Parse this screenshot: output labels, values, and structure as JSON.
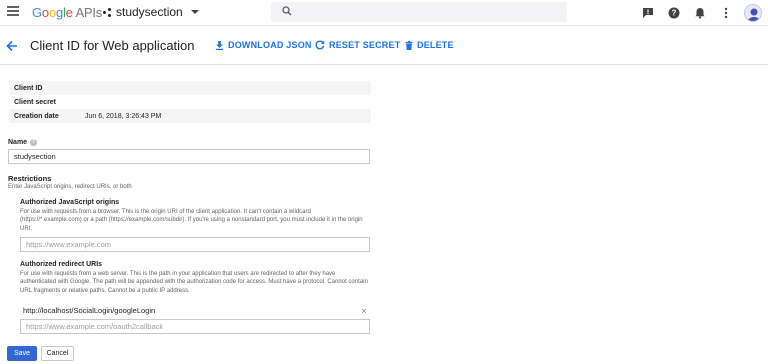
{
  "appbar": {
    "logo_parts": [
      "G",
      "o",
      "o",
      "g",
      "l",
      "e"
    ],
    "logo_suffix": "APIs",
    "project_name": "studysection",
    "search_placeholder": "",
    "icons": [
      "menu-icon",
      "support-icon",
      "help-icon",
      "notifications-icon",
      "more-vert-icon",
      "account-avatar"
    ]
  },
  "header": {
    "title": "Client ID for Web application",
    "actions": {
      "download": "DOWNLOAD JSON",
      "reset": "RESET SECRET",
      "delete": "DELETE"
    }
  },
  "info": {
    "client_id_label": "Client ID",
    "client_id_value": "",
    "client_secret_label": "Client secret",
    "client_secret_value": "",
    "creation_date_label": "Creation date",
    "creation_date_value": "Jun 6, 2018, 3:26:43 PM"
  },
  "name": {
    "label": "Name",
    "value": "studysection"
  },
  "restrictions": {
    "title": "Restrictions",
    "subtitle": "Enter JavaScript origins, redirect URIs, or both",
    "origins": {
      "title": "Authorized JavaScript origins",
      "desc": "For use with requests from a browser. This is the origin URI of the client application. It can't contain a wildcard (https://*.example.com) or a path (https://example.com/subdir). If you're using a nonstandard port, you must include it in the origin URI.",
      "placeholder": "https://www.example.com"
    },
    "redirects": {
      "title": "Authorized redirect URIs",
      "desc": "For use with requests from a web server. This is the path in your application that users are redirected to after they have authenticated with Google. The path will be appended with the authorization code for access. Must have a protocol. Cannot contain URL fragments or relative paths. Cannot be a public IP address.",
      "entries": [
        "http://localhost/SocialLogin/googleLogin"
      ],
      "remove_glyph": "×",
      "placeholder": "https://www.example.com/oauth2callback"
    }
  },
  "buttons": {
    "save": "Save",
    "cancel": "Cancel"
  },
  "colors": {
    "primary": "#3367d6",
    "link": "#1a73e8"
  }
}
